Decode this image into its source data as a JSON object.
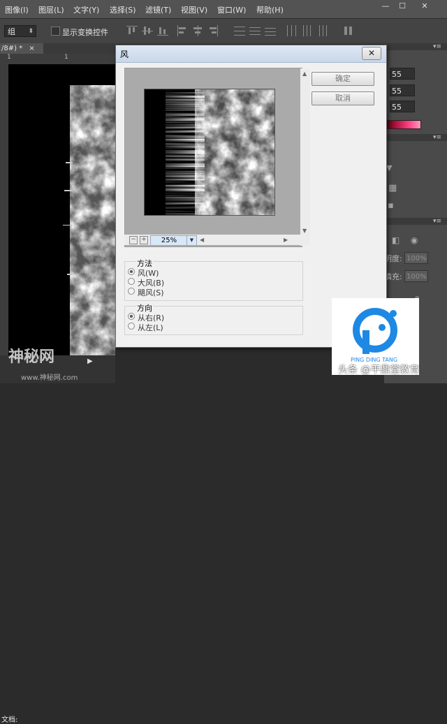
{
  "menubar": {
    "items": [
      "图像(I)",
      "图层(L)",
      "文字(Y)",
      "选择(S)",
      "滤镜(T)",
      "视图(V)",
      "窗口(W)",
      "帮助(H)"
    ]
  },
  "options": {
    "select_value": "组",
    "checkbox_label": "显示变换控件"
  },
  "document": {
    "tab_label": "/8#) *",
    "status_text": "文档:"
  },
  "right_panel": {
    "field1": "55",
    "field2": "55",
    "field3": "55",
    "opacity_label": "明度:",
    "opacity_value": "100%",
    "fill_label": "填充:",
    "fill_value": "100%"
  },
  "dialog": {
    "title": "风",
    "ok_label": "确定",
    "cancel_label": "取消",
    "zoom": "25%",
    "zoom_minus": "−",
    "zoom_plus": "+",
    "method_title": "方法",
    "method_options": [
      "风(W)",
      "大风(B)",
      "飓风(S)"
    ],
    "method_selected": 0,
    "direction_title": "方向",
    "direction_options": [
      "从右(R)",
      "从左(L)"
    ],
    "direction_selected": 0
  },
  "watermark": {
    "left_text": "神秘网",
    "left_url": "www.神秘网.com",
    "logo_text": "PING DING TANG",
    "caption": "头条 @平鼎堂教育"
  },
  "colors": {
    "accent_logo": "#1e88e5",
    "dialog_bg": "#f0f0f0",
    "ps_chrome": "#535353"
  }
}
